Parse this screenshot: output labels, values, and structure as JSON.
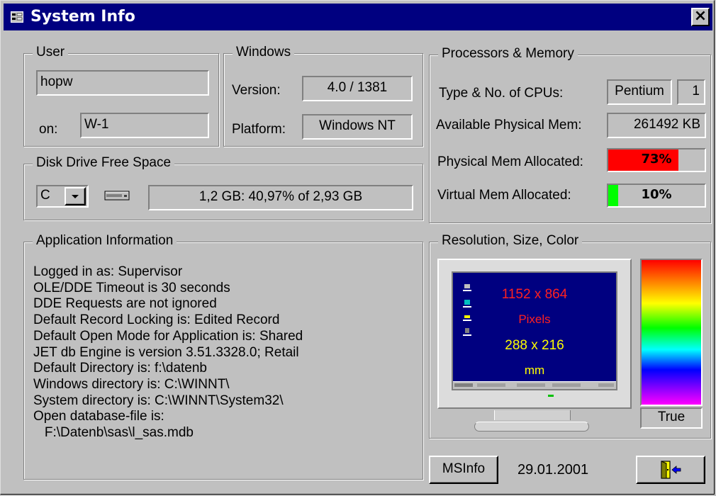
{
  "window": {
    "title": "System Info",
    "close_label": "×"
  },
  "user": {
    "legend": "User",
    "username": "hopw",
    "on_label": "on:",
    "machine": "W-1"
  },
  "windows": {
    "legend": "Windows",
    "version_label": "Version:",
    "version": "4.0 / 1381",
    "platform_label": "Platform:",
    "platform": "Windows NT"
  },
  "disk": {
    "legend": "Disk Drive Free Space",
    "drive": "C",
    "free_space": "1,2 GB: 40,97% of 2,93 GB"
  },
  "processors": {
    "legend": "Processors & Memory",
    "cpu_label": "Type & No. of CPUs:",
    "cpu_type": "Pentium",
    "cpu_count": "1",
    "avail_mem_label": "Available Physical Mem:",
    "avail_mem": "261492 KB",
    "phys_alloc_label": "Physical Mem Allocated:",
    "phys_alloc_text": "73%",
    "phys_alloc_value": 0.73,
    "phys_alloc_color": "#ff0000",
    "virt_alloc_label": "Virtual Mem Allocated:",
    "virt_alloc_text": "10%",
    "virt_alloc_value": 0.1,
    "virt_alloc_color": "#00ff00"
  },
  "application": {
    "legend": "Application Information",
    "lines": [
      "Logged in as: Supervisor",
      "OLE/DDE Timeout is 30 seconds",
      "DDE Requests are not ignored",
      "Default Record Locking is: Edited Record",
      "Default Open Mode for Application is: Shared",
      "JET db Engine is version 3.51.3328.0; Retail",
      "Default Directory is: f:\\datenb",
      "Windows directory is: C:\\WINNT\\",
      "System directory is: C:\\WINNT\\System32\\",
      "Open database-file is:",
      "   F:\\Datenb\\sas\\l_sas.mdb"
    ]
  },
  "display": {
    "legend": "Resolution, Size, Color",
    "resolution": "1152 x 864",
    "resolution_unit": "Pixels",
    "size": "288 x 216",
    "size_unit": "mm",
    "color_depth": "True",
    "screen_color": "#000080",
    "resolution_color": "#ff2020",
    "size_color": "#ffff00"
  },
  "footer": {
    "msinfo_label": "MSInfo",
    "date": "29.01.2001"
  },
  "icons": {
    "title": "form-icon",
    "drive": "hard-drive-icon",
    "exit": "exit-door-icon",
    "dropdown": "chevron-down-icon"
  }
}
